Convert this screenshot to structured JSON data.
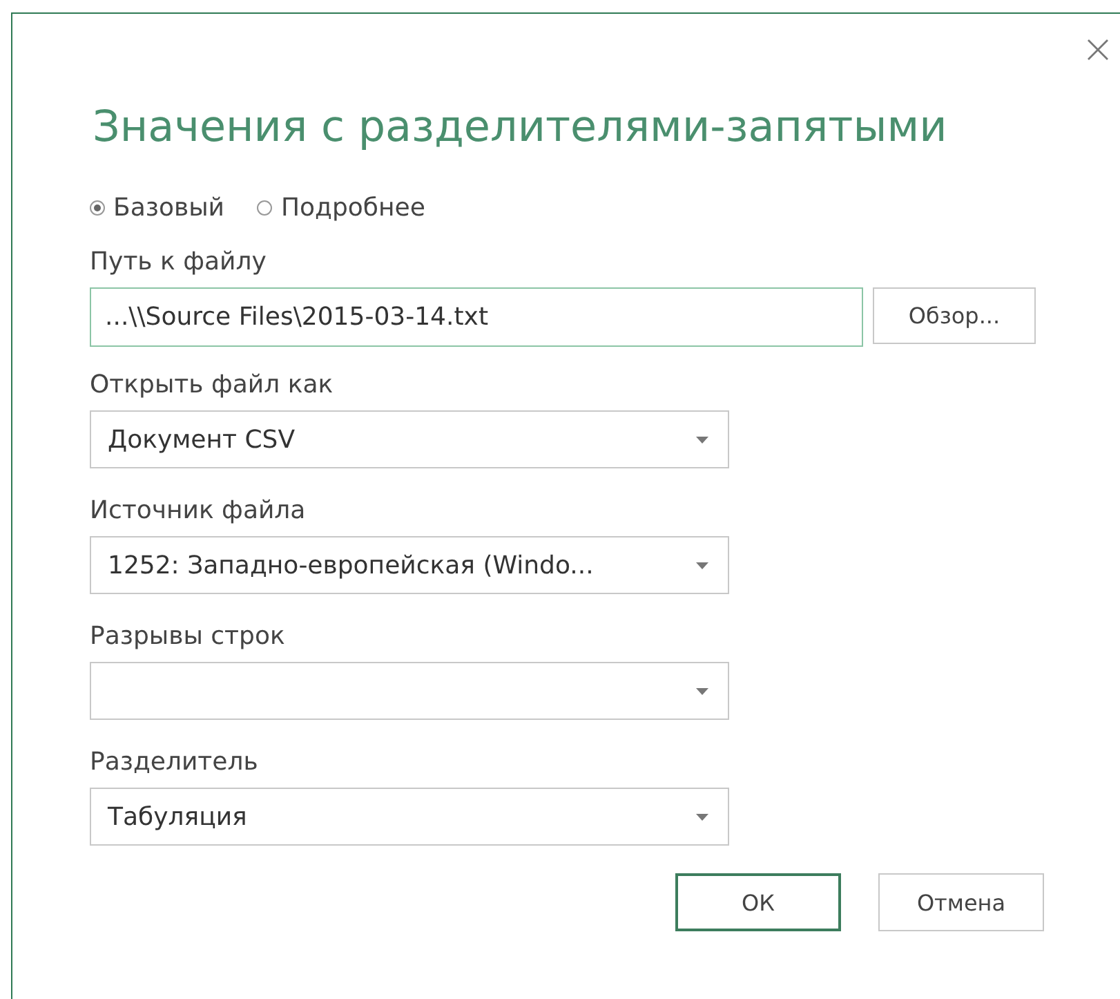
{
  "title": "Значения с разделителями-запятыми",
  "modes": [
    {
      "label": "Базовый",
      "selected": true
    },
    {
      "label": "Подробнее",
      "selected": false
    }
  ],
  "path": {
    "label": "Путь к файлу",
    "value": "...\\\\Source Files\\2015-03-14.txt",
    "focused": true
  },
  "browse_button": "Обзор...",
  "dropdowns": [
    {
      "label": "Открыть файл как",
      "value": "Документ CSV"
    },
    {
      "label": "Источник файла",
      "value": "1252: Западно-европейская (Windo..."
    },
    {
      "label": "Разрывы строк"
    },
    {
      "label": "Разделитель",
      "value": "Табуляция"
    }
  ],
  "buttons": [
    {
      "label": "ОК",
      "kind": "primary"
    },
    {
      "label": "Отмена",
      "kind": "secondary"
    }
  ]
}
